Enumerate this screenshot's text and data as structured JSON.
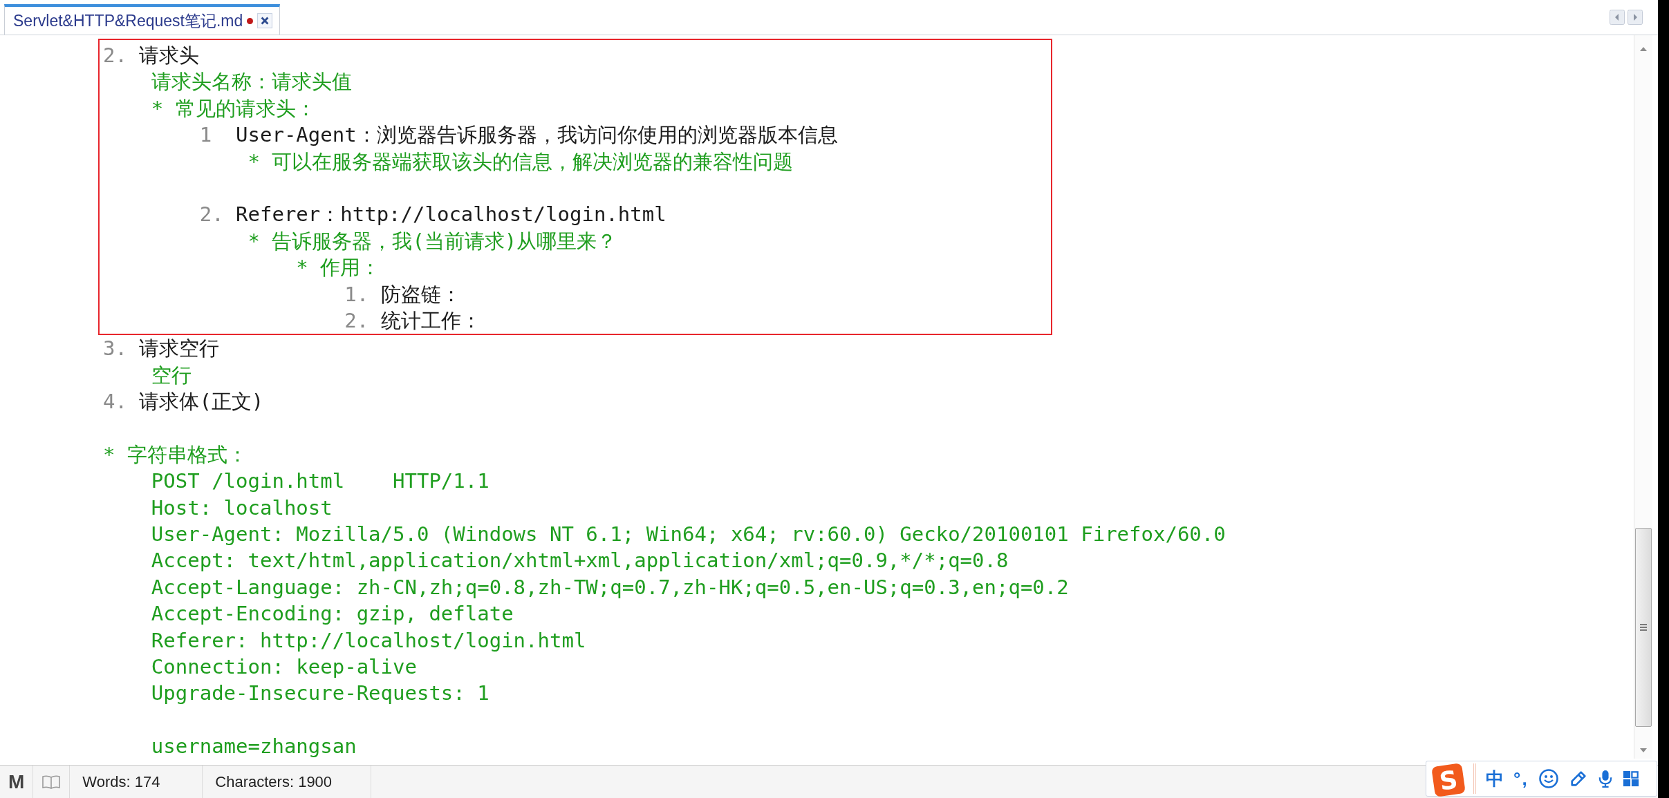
{
  "tab": {
    "title": "Servlet&HTTP&Request笔记.md",
    "modified": true,
    "selected": true
  },
  "editor": {
    "blocks": [
      {
        "kind": "box",
        "children": [
          {
            "kind": "numbered",
            "marker": "2.",
            "text": "请求头",
            "children": [
              {
                "kind": "text",
                "text": "请求头名称：请求头值"
              },
              {
                "kind": "bullet",
                "marker": "*",
                "text": "常见的请求头：",
                "children": [
                  {
                    "kind": "numbered",
                    "marker": "1",
                    "text": "User-Agent：浏览器告诉服务器，我访问你使用的浏览器版本信息",
                    "children": [
                      {
                        "kind": "bullet",
                        "marker": "*",
                        "text": "可以在服务器端获取该头的信息，解决浏览器的兼容性问题"
                      }
                    ]
                  },
                  {
                    "kind": "blank"
                  },
                  {
                    "kind": "numbered",
                    "marker": "2.",
                    "text": "Referer：http://localhost/login.html",
                    "children": [
                      {
                        "kind": "bullet",
                        "marker": "*",
                        "text": "告诉服务器，我(当前请求)从哪里来？",
                        "children": [
                          {
                            "kind": "bullet",
                            "marker": "*",
                            "text": "作用：",
                            "children": [
                              {
                                "kind": "numbered",
                                "marker": "1.",
                                "text": "防盗链："
                              },
                              {
                                "kind": "numbered",
                                "marker": "2.",
                                "text": "统计工作："
                              }
                            ]
                          }
                        ]
                      }
                    ]
                  }
                ]
              }
            ]
          }
        ]
      },
      {
        "kind": "numbered",
        "marker": "3.",
        "text": "请求空行",
        "children": [
          {
            "kind": "text",
            "text": "空行"
          }
        ]
      },
      {
        "kind": "numbered",
        "marker": "4.",
        "text": "请求体(正文)"
      },
      {
        "kind": "blank"
      },
      {
        "kind": "bullet",
        "marker": "*",
        "text": "字符串格式：",
        "children": [
          {
            "kind": "code",
            "text": "POST /login.html    HTTP/1.1"
          },
          {
            "kind": "code",
            "text": "Host: localhost"
          },
          {
            "kind": "code",
            "text": "User-Agent: Mozilla/5.0 (Windows NT 6.1; Win64; x64; rv:60.0) Gecko/20100101 Firefox/60.0"
          },
          {
            "kind": "code",
            "text": "Accept: text/html,application/xhtml+xml,application/xml;q=0.9,*/*;q=0.8"
          },
          {
            "kind": "code",
            "text": "Accept-Language: zh-CN,zh;q=0.8,zh-TW;q=0.7,zh-HK;q=0.5,en-US;q=0.3,en;q=0.2"
          },
          {
            "kind": "code",
            "text": "Accept-Encoding: gzip, deflate"
          },
          {
            "kind": "code",
            "text": "Referer: http://localhost/login.html"
          },
          {
            "kind": "code",
            "text": "Connection: keep-alive"
          },
          {
            "kind": "code",
            "text": "Upgrade-Insecure-Requests: 1"
          },
          {
            "kind": "blank"
          },
          {
            "kind": "code",
            "text": "username=zhangsan"
          }
        ]
      }
    ]
  },
  "status_bar": {
    "mode_label": "M",
    "words": "Words: 174",
    "characters": "Characters: 1900"
  },
  "ime_toolbar": {
    "logo": "S",
    "mode": "中",
    "punctuation": "°,"
  }
}
